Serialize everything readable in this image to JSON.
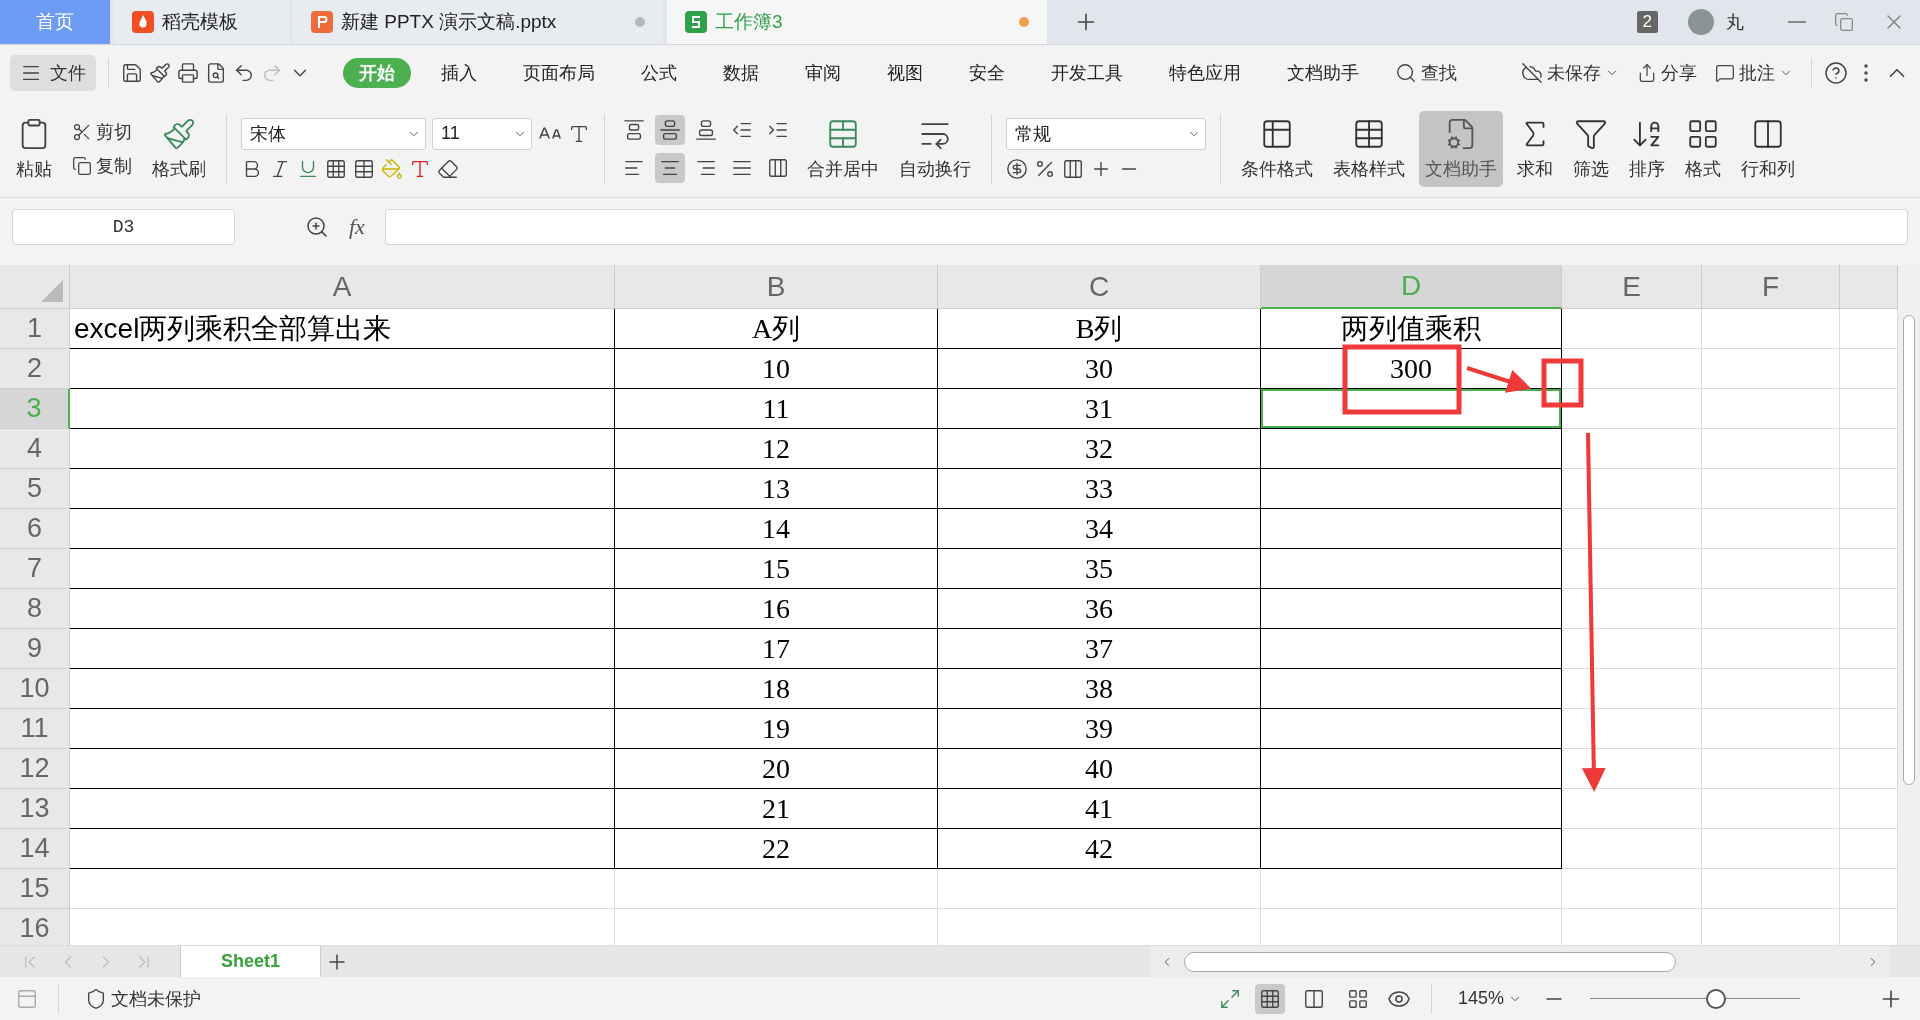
{
  "tabs": [
    {
      "label": "首页",
      "kind": "home",
      "selected": false
    },
    {
      "label": "稻壳模板",
      "kind": "docer",
      "selected": false
    },
    {
      "label": "新建 PPTX 演示文稿.pptx",
      "kind": "ppt",
      "selected": false,
      "color": "#b8b8b8"
    },
    {
      "label": "工作簿3",
      "kind": "sheet",
      "selected": true,
      "color": "#f0a050"
    }
  ],
  "window_badge": "2",
  "user": "丸",
  "menu": {
    "file": "文件",
    "items": [
      {
        "label": "开始",
        "selected": true
      },
      {
        "label": "插入",
        "selected": false
      },
      {
        "label": "页面布局",
        "selected": false
      },
      {
        "label": "公式",
        "selected": false
      },
      {
        "label": "数据",
        "selected": false
      },
      {
        "label": "审阅",
        "selected": false
      },
      {
        "label": "视图",
        "selected": false
      },
      {
        "label": "安全",
        "selected": false
      },
      {
        "label": "开发工具",
        "selected": false
      },
      {
        "label": "特色应用",
        "selected": false
      },
      {
        "label": "文档助手",
        "selected": false
      }
    ],
    "search": "查找",
    "save": "未保存",
    "share": "分享",
    "comment": "批注"
  },
  "ribbon": {
    "paste": "粘贴",
    "cut": "剪切",
    "copy": "复制",
    "painter": "格式刷",
    "font": "宋体",
    "size": "11",
    "merge": "合并居中",
    "wrap": "自动换行",
    "number_format": "常规",
    "align_top": [
      {
        "kind": "top",
        "selected": false
      },
      {
        "kind": "middle",
        "selected": true
      },
      {
        "kind": "bottom",
        "selected": false
      },
      {
        "kind": "outdent",
        "selected": false
      },
      {
        "kind": "indent",
        "selected": false
      }
    ],
    "align_row": [
      {
        "kind": "left",
        "selected": false
      },
      {
        "kind": "center",
        "selected": true
      },
      {
        "kind": "right",
        "selected": false
      },
      {
        "kind": "justify",
        "selected": false
      },
      {
        "kind": "distribute",
        "selected": false
      }
    ],
    "tools": [
      {
        "label": "条件格式",
        "kind": "conditional",
        "selected": false
      },
      {
        "label": "表格样式",
        "kind": "style",
        "selected": false
      },
      {
        "label": "文档助手",
        "kind": "assistant",
        "selected": true
      },
      {
        "label": "求和",
        "kind": "sum",
        "selected": false
      },
      {
        "label": "筛选",
        "kind": "filter",
        "selected": false
      },
      {
        "label": "排序",
        "kind": "sort",
        "selected": false
      },
      {
        "label": "格式",
        "kind": "format",
        "selected": false
      },
      {
        "label": "行和列",
        "kind": "rowcol",
        "selected": false
      }
    ]
  },
  "formula_bar": {
    "name_box": "D3",
    "fx": "fx"
  },
  "columns": [
    {
      "label": "A",
      "selected": false
    },
    {
      "label": "B",
      "selected": false
    },
    {
      "label": "C",
      "selected": false
    },
    {
      "label": "D",
      "selected": true
    },
    {
      "label": "E",
      "selected": false
    },
    {
      "label": "F",
      "selected": false
    }
  ],
  "rows": [
    {
      "label": "1",
      "selected": false,
      "cells": [
        "excel两列乘积全部算出来",
        "A列",
        "B列",
        "两列值乘积"
      ]
    },
    {
      "label": "2",
      "selected": false,
      "cells": [
        "",
        "10",
        "30",
        "300"
      ]
    },
    {
      "label": "3",
      "selected": true,
      "cells": [
        "",
        "11",
        "31",
        ""
      ]
    },
    {
      "label": "4",
      "selected": false,
      "cells": [
        "",
        "12",
        "32",
        ""
      ]
    },
    {
      "label": "5",
      "selected": false,
      "cells": [
        "",
        "13",
        "33",
        ""
      ]
    },
    {
      "label": "6",
      "selected": false,
      "cells": [
        "",
        "14",
        "34",
        ""
      ]
    },
    {
      "label": "7",
      "selected": false,
      "cells": [
        "",
        "15",
        "35",
        ""
      ]
    },
    {
      "label": "8",
      "selected": false,
      "cells": [
        "",
        "16",
        "36",
        ""
      ]
    },
    {
      "label": "9",
      "selected": false,
      "cells": [
        "",
        "17",
        "37",
        ""
      ]
    },
    {
      "label": "10",
      "selected": false,
      "cells": [
        "",
        "18",
        "38",
        ""
      ]
    },
    {
      "label": "11",
      "selected": false,
      "cells": [
        "",
        "19",
        "39",
        ""
      ]
    },
    {
      "label": "12",
      "selected": false,
      "cells": [
        "",
        "20",
        "40",
        ""
      ]
    },
    {
      "label": "13",
      "selected": false,
      "cells": [
        "",
        "21",
        "41",
        ""
      ]
    },
    {
      "label": "14",
      "selected": false,
      "cells": [
        "",
        "22",
        "42",
        ""
      ]
    },
    {
      "label": "15",
      "selected": false,
      "cells": []
    },
    {
      "label": "16",
      "selected": false,
      "cells": []
    }
  ],
  "sheets": [
    {
      "label": "Sheet1",
      "selected": true
    }
  ],
  "status": {
    "protect": "文档未保护",
    "views": [
      {
        "kind": "normal",
        "selected": true
      },
      {
        "kind": "pagebreak",
        "selected": false
      },
      {
        "kind": "layout",
        "selected": false
      }
    ],
    "zoom": "145%",
    "level": 0.6
  }
}
